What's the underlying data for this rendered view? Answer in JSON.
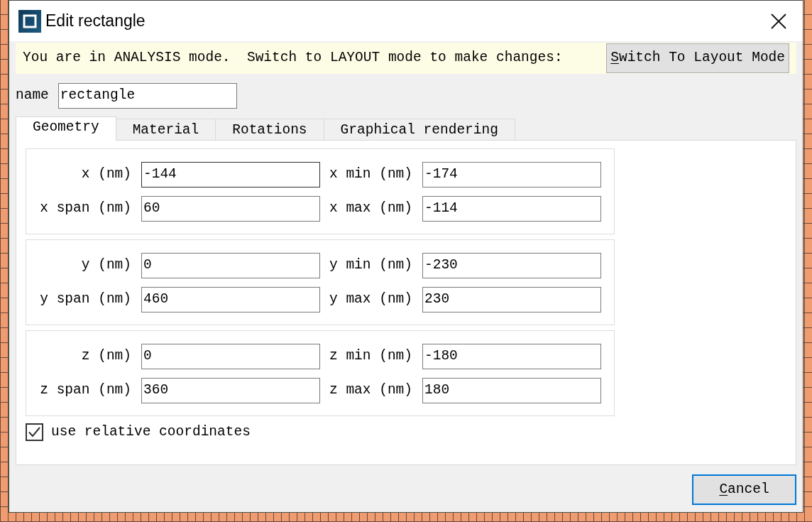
{
  "window": {
    "title": "Edit rectangle"
  },
  "banner": {
    "message": "You are in ANALYSIS mode.  Switch to LAYOUT mode to make changes:",
    "button": {
      "label": "Switch To Layout Mode",
      "shortcut_underlined": true
    }
  },
  "name_field": {
    "label": "name",
    "value": "rectangle"
  },
  "tabs": [
    {
      "label": "Geometry",
      "selected": true
    },
    {
      "label": "Material",
      "selected": false
    },
    {
      "label": "Rotations",
      "selected": false
    },
    {
      "label": "Graphical rendering",
      "selected": false
    }
  ],
  "groups": [
    {
      "rows": [
        [
          {
            "label": "x (nm)",
            "value": "-144",
            "focused": true
          },
          {
            "label": "x min (nm)",
            "value": "-174",
            "focused": false
          }
        ],
        [
          {
            "label": "x span (nm)",
            "value": "60",
            "focused": false
          },
          {
            "label": "x max (nm)",
            "value": "-114",
            "focused": false
          }
        ]
      ]
    },
    {
      "rows": [
        [
          {
            "label": "y (nm)",
            "value": "0",
            "focused": false
          },
          {
            "label": "y min (nm)",
            "value": "-230",
            "focused": false
          }
        ],
        [
          {
            "label": "y span (nm)",
            "value": "460",
            "focused": false
          },
          {
            "label": "y max (nm)",
            "value": "230",
            "focused": false
          }
        ]
      ]
    },
    {
      "rows": [
        [
          {
            "label": "z (nm)",
            "value": "0",
            "focused": false
          },
          {
            "label": "z min (nm)",
            "value": "-180",
            "focused": false
          }
        ],
        [
          {
            "label": "z span (nm)",
            "value": "360",
            "focused": false
          },
          {
            "label": "z max (nm)",
            "value": "180",
            "focused": false
          }
        ]
      ]
    }
  ],
  "checkbox": {
    "label": "use relative coordinates",
    "checked": true
  },
  "buttons": [
    {
      "label": "Cancel",
      "shortcut_underlined": true
    }
  ]
}
